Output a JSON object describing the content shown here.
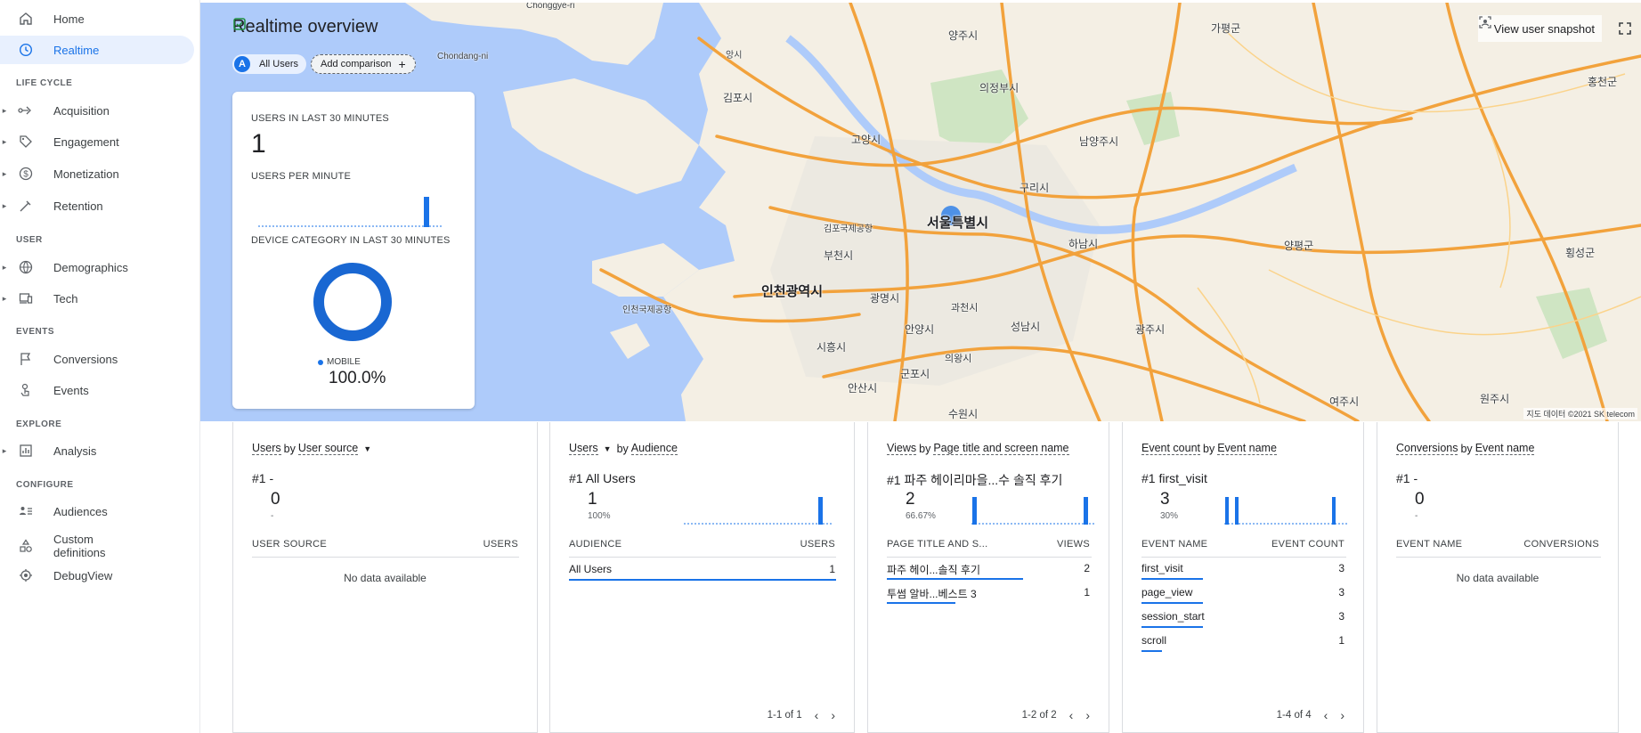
{
  "sidebar": {
    "home": "Home",
    "realtime": "Realtime",
    "sections": {
      "lifecycle": "LIFE CYCLE",
      "user": "USER",
      "events": "EVENTS",
      "explore": "EXPLORE",
      "configure": "CONFIGURE"
    },
    "acquisition": "Acquisition",
    "engagement": "Engagement",
    "monetization": "Monetization",
    "retention": "Retention",
    "demographics": "Demographics",
    "tech": "Tech",
    "conversions": "Conversions",
    "events": "Events",
    "analysis": "Analysis",
    "audiences": "Audiences",
    "custom_definitions": "Custom definitions",
    "debugview": "DebugView"
  },
  "header": {
    "title": "Realtime overview",
    "chip_all_avatar": "A",
    "chip_all": "All Users",
    "chip_add": "Add comparison",
    "snapshot": "View user snapshot"
  },
  "map": {
    "cities": {
      "seoul": "서울특별시",
      "incheon": "인천광역시",
      "bucheon": "부천시",
      "goyang": "고양시",
      "gimpo": "김포시",
      "uijeongbu": "의정부시",
      "namyangju": "남양주시",
      "guri": "구리시",
      "hanam": "하남시",
      "seongnam": "성남시",
      "gwangmyeong": "광명시",
      "anyang": "안양시",
      "siheung": "시흥시",
      "gunpo": "군포시",
      "ansan": "안산시",
      "gwacheon": "과천시",
      "uiwang": "의왕시",
      "suwon": "수원시",
      "gwangju": "광주시",
      "yangpyeong": "양평군",
      "hoengseong": "횡성군",
      "hongcheon": "홍천군",
      "yeoju": "여주시",
      "wonju": "원주시",
      "gapyeong": "가평군",
      "yangju": "양주시",
      "gimpo_airport": "김포국제공항",
      "incheon_airport": "인천국제공항",
      "chonggye": "Chonggye-ri",
      "chondang": "Chondang-ni",
      "hangsi": "앙시"
    },
    "credit": "지도 데이터 ©2021 SK telecom"
  },
  "overview": {
    "users_30_label": "USERS IN LAST 30 MINUTES",
    "users_30_value": "1",
    "per_minute_label": "USERS PER MINUTE",
    "device_label": "DEVICE CATEGORY IN LAST 30 MINUTES",
    "legend_label": "MOBILE",
    "legend_value": "100.0%"
  },
  "card_source": {
    "title_metric": "Users",
    "title_by": "by",
    "title_dim": "User source",
    "rank": "#1  -",
    "value": "0",
    "pct": "-",
    "col1": "USER SOURCE",
    "col2": "USERS",
    "nodata": "No data available"
  },
  "card_audience": {
    "title_metric": "Users",
    "title_by": "by",
    "title_dim": "Audience",
    "rank": "#1  All Users",
    "value": "1",
    "pct": "100%",
    "col1": "AUDIENCE",
    "col2": "USERS",
    "rows": [
      {
        "label": "All Users",
        "value": "1"
      }
    ],
    "pager": "1-1 of 1"
  },
  "card_views": {
    "title_metric": "Views",
    "title_by": "by",
    "title_dim": "Page title and screen name",
    "rank": "#1  파주 헤이리마을...수 솔직 후기",
    "value": "2",
    "pct": "66.67%",
    "col1": "PAGE TITLE AND S...",
    "col2": "VIEWS",
    "rows": [
      {
        "label": "파주 헤이...솔직 후기",
        "value": "2"
      },
      {
        "label": "투썸 알바...베스트 3",
        "value": "1"
      }
    ],
    "pager": "1-2 of 2"
  },
  "card_events": {
    "title_metric": "Event count",
    "title_by": "by",
    "title_dim": "Event name",
    "rank": "#1  first_visit",
    "value": "3",
    "pct": "30%",
    "col1": "EVENT NAME",
    "col2": "EVENT COUNT",
    "rows": [
      {
        "label": "first_visit",
        "value": "3"
      },
      {
        "label": "page_view",
        "value": "3"
      },
      {
        "label": "session_start",
        "value": "3"
      },
      {
        "label": "scroll",
        "value": "1"
      }
    ],
    "pager": "1-4 of 4"
  },
  "card_conversions": {
    "title_metric": "Conversions",
    "title_by": "by",
    "title_dim": "Event name",
    "rank": "#1  -",
    "value": "0",
    "pct": "-",
    "col1": "EVENT NAME",
    "col2": "CONVERSIONS",
    "nodata": "No data available"
  },
  "colors": {
    "accent": "#1a73e8",
    "map_water": "#aecbfa",
    "map_land": "#f4efe4",
    "map_road": "#f2a23c"
  }
}
